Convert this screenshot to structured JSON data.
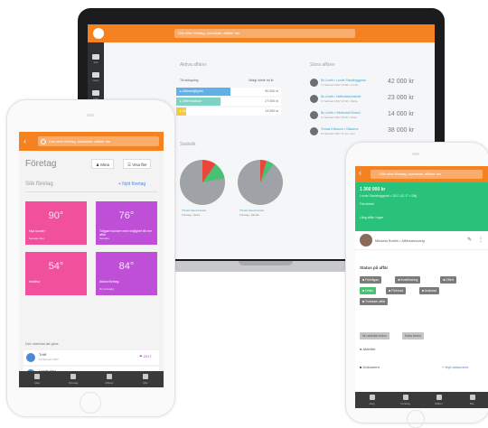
{
  "colors": {
    "brand": "#f58220",
    "green": "#28c27a",
    "pink": "#f0509c",
    "purple": "#c04fd8",
    "blue": "#4b89d0",
    "dark": "#2f3235"
  },
  "laptop": {
    "search_placeholder": "Sök efter företag, kontakter, affärer etc",
    "sidebar": [
      {
        "icon": "inbox-icon",
        "label": "Start"
      },
      {
        "icon": "chart-icon",
        "label": "Analys"
      },
      {
        "icon": "list-icon",
        "label": "Lista"
      }
    ],
    "pipeline": {
      "title": "Aktiva affärer",
      "header_left": "Till stängning",
      "header_right": "Utlagt värde tot kr",
      "rows": [
        {
          "label": "Affärsmöjlighet",
          "value": "50 000 kr",
          "color": "#62b0e8",
          "fill": 1.0
        },
        {
          "label": "Offert skickad",
          "value": "27 000 kr",
          "color": "#7ed3c4",
          "fill": 0.82
        },
        {
          "label": "Order",
          "value": "14 000 kr",
          "color": "#f5c842",
          "fill": 0.18
        }
      ]
    },
    "activity": {
      "title": "Stora affärer",
      "items": [
        {
          "line1": "Bo Lindh • Lunds Stadsbyggnad",
          "line2": "17 februari 2017 14:08 • Lunds",
          "amount": "42 000 kr"
        },
        {
          "line1": "Bo Lindh • Vattenlaboratoriet",
          "line2": "17 februari 2017 10:46 • Marie",
          "amount": "23 000 kr"
        },
        {
          "line1": "Bo Lindh • Växthuset Rosen",
          "line2": "17 februari 2017 09:20 • Peter",
          "amount": "14 000 kr"
        },
        {
          "line1": "Tomas Eriksson • Gåsarna",
          "line2": "16 februari 2017 11:12 • Ann",
          "amount": "38 000 kr"
        }
      ]
    },
    "stats": {
      "title": "Statistik",
      "pie1": {
        "label": "Tillväxt bland kunder",
        "sub": "Företag • Stora",
        "share": 0.22
      },
      "pie2": {
        "label": "Tillväxt bland kunder",
        "sub": "Företag • Mindre",
        "share": 0.1
      }
    }
  },
  "left_phone": {
    "search_placeholder": "Sök efter företag, kontakter, affärer etc",
    "page_title": "Företag",
    "btn_mina": "Mina",
    "btn_visa_fler": "Visa fler",
    "search_subtitle": "Sök företag",
    "add_button": "+ Nytt företag",
    "tiles": [
      {
        "value": "90",
        "caption": "Nya kunder",
        "sub": "Senaste året",
        "color": "#f0509c"
      },
      {
        "value": "76",
        "caption": "Tidigare kunder med möjlighet till mer affär",
        "sub": "Senaste",
        "color": "#c04fd8"
      },
      {
        "value": "54",
        "caption": "Inaktiva",
        "sub": "",
        "color": "#f0509c"
      },
      {
        "value": "84",
        "caption": "Aktiva företag",
        "sub": "Ny ansvarig",
        "color": "#c04fd8"
      }
    ],
    "next_title": "Det närmsta att göra",
    "tasks": [
      {
        "title": "Träff",
        "date": "12 februari 2017",
        "flag": "2017"
      },
      {
        "title": "Lunds dag",
        "date": "15 februari 2017",
        "flag": "2017"
      }
    ],
    "nav": [
      {
        "icon": "home-icon",
        "label": "Idag"
      },
      {
        "icon": "building-icon",
        "label": "Företag"
      },
      {
        "icon": "deal-icon",
        "label": "Affärer"
      },
      {
        "icon": "more-icon",
        "label": "Mer"
      }
    ]
  },
  "right_phone": {
    "search_placeholder": "Sök efter företag, kontakter, affärer etc",
    "deal_amount": "1 300 000 kr",
    "deal_company": "Lunds Stadsbyggnad • 2017-02-17 • Sälj",
    "deal_label": "Förväntad",
    "deal_sub": "Lång affär i lager",
    "user_name": "Mikaela Bohlin • Affärsansvarig",
    "status_title": "Status på affär",
    "stages_row1": [
      "Förfrågan",
      "Kvalificering",
      "Offert"
    ],
    "stages_row2": [
      "Order",
      "Förlorad",
      "Avslutad"
    ],
    "stages_row3": [
      "Tveksam affär"
    ],
    "active_stage": "Order",
    "actions": [
      "Nu aktivitet krävs",
      "Kalla ändra"
    ],
    "items": [
      {
        "icon": "chat-icon",
        "label": "Aktivitet"
      },
      {
        "icon": "doc-icon",
        "label": "Dokument",
        "extra": "+ Nytt dokument"
      }
    ],
    "nav": [
      {
        "icon": "home-icon",
        "label": "Idag"
      },
      {
        "icon": "building-icon",
        "label": "Företag"
      },
      {
        "icon": "deal-icon",
        "label": "Affärer"
      },
      {
        "icon": "more-icon",
        "label": "Mer"
      }
    ]
  }
}
